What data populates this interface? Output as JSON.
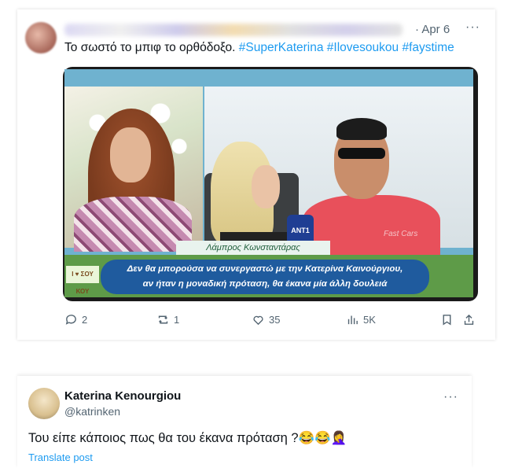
{
  "tweet1": {
    "date": "· Apr 6",
    "more": "···",
    "text": "Το σωστό το μπιφ το ορθόδοξο.",
    "hashtags": [
      "#SuperKaterina",
      "#Ilovesoukou",
      "#faystime"
    ],
    "video": {
      "name_plate": "Λάμπρος Κωνσταντάρας",
      "caption_line1": "Δεν θα μπορούσα να συνεργαστώ με την Κατερίνα Καινούργιου,",
      "caption_line2": "αν ήταν η μοναδική πρόταση, θα έκανα μία άλλη δουλειά",
      "logo_text": "I ♥ ΣΟΥ ΚΟΥ",
      "mic_text": "ANT1",
      "shirt_text": "Fast Cars"
    },
    "actions": {
      "replies": "2",
      "reposts": "1",
      "likes": "35",
      "views": "5K"
    }
  },
  "tweet2": {
    "name": "Katerina Kenourgiou",
    "handle": "@katrinken",
    "more": "···",
    "text": "Του είπε κάποιος πως θα του έκανα πρόταση ?😂😂🤦‍♀️",
    "translate": "Translate post"
  },
  "colors": {
    "accent": "#1d9bf0",
    "muted": "#536471",
    "text": "#0f1419"
  }
}
